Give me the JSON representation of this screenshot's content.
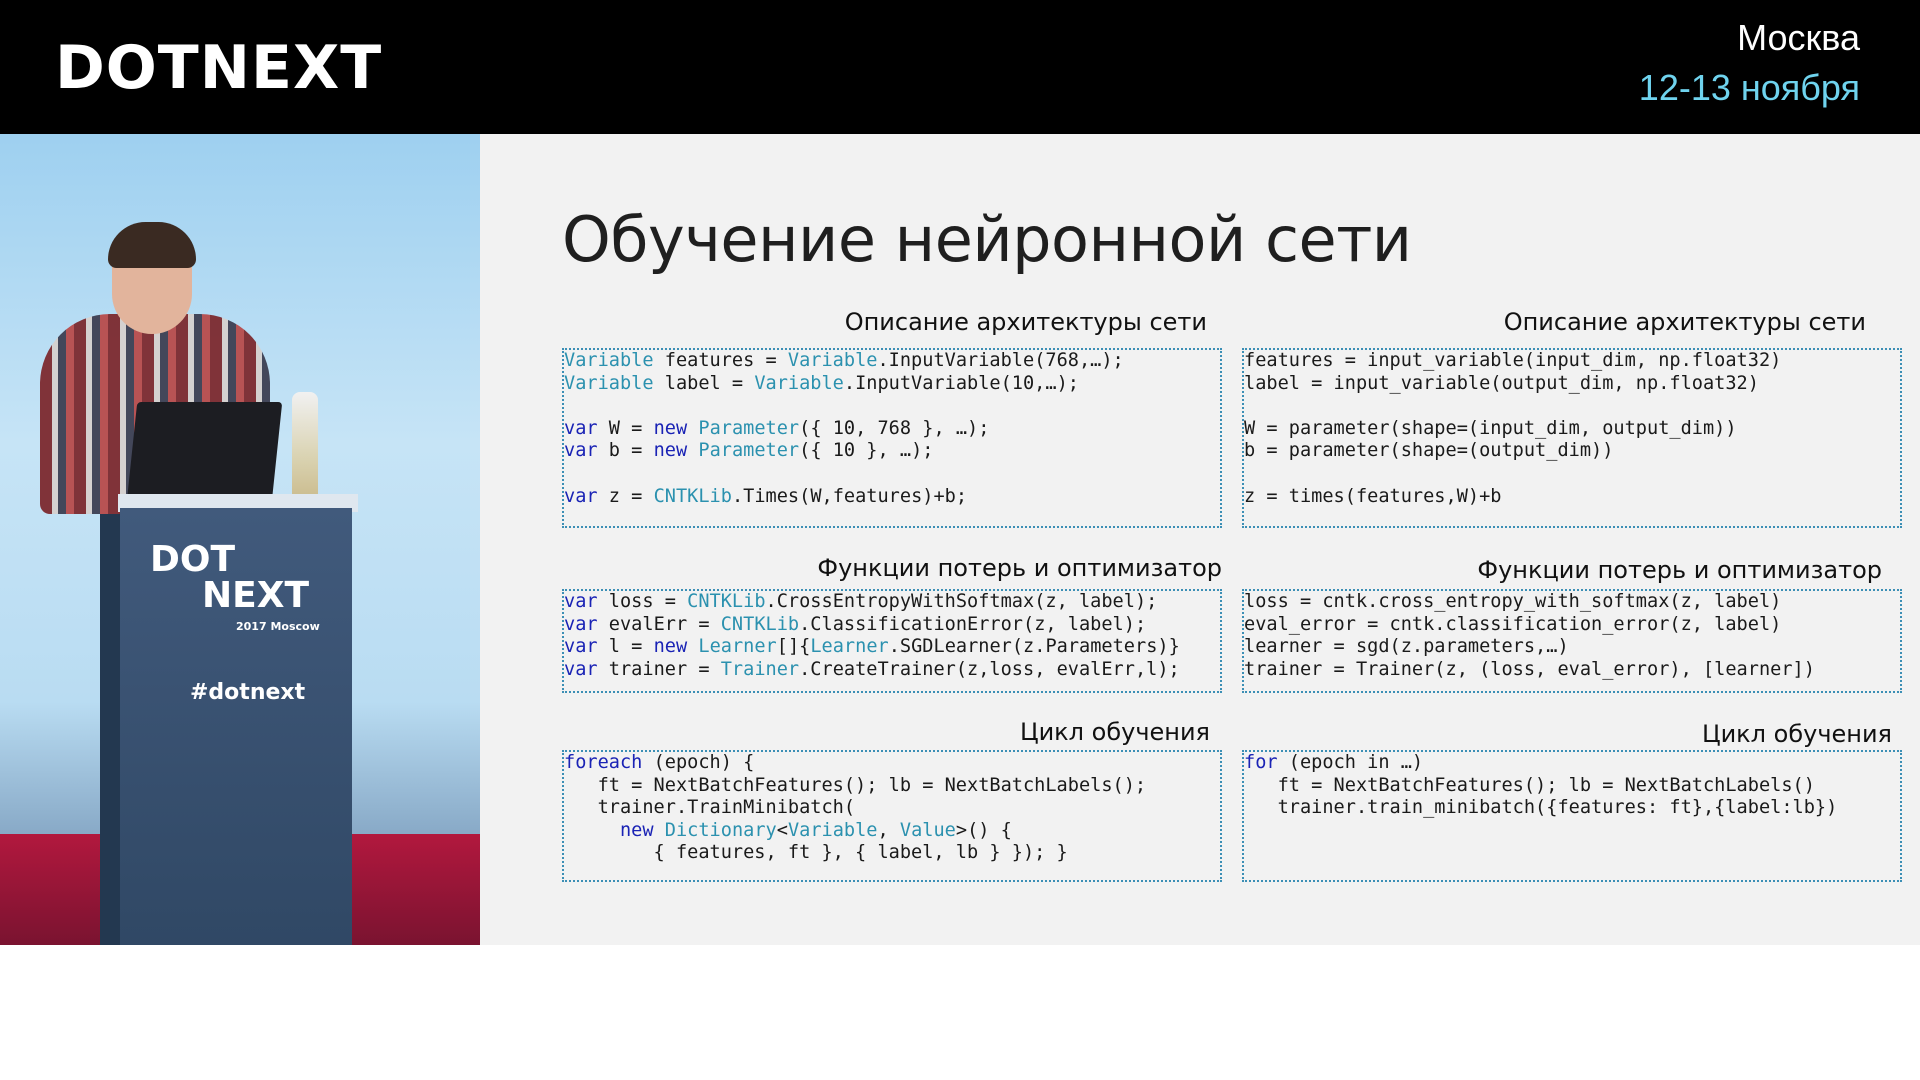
{
  "header": {
    "logo": "DOTNEXT",
    "city": "Москва",
    "dates": "12-13 ноября"
  },
  "podium": {
    "logo_line1": "DOT",
    "logo_line2": "NEXT",
    "logo_sub": "2017 Moscow",
    "hashtag": "#dotnext"
  },
  "slide": {
    "title": "Обучение нейронной сети",
    "left": {
      "arch_label": "Описание архитектуры сети",
      "loss_label": "Функции потерь и оптимизатор",
      "loop_label": "Цикл обучения",
      "arch_code": [
        [
          [
            "ty",
            "Variable"
          ],
          [
            "p",
            " features = "
          ],
          [
            "ty",
            "Variable"
          ],
          [
            "p",
            ".InputVariable(768,…);"
          ]
        ],
        [
          [
            "ty",
            "Variable"
          ],
          [
            "p",
            " label = "
          ],
          [
            "ty",
            "Variable"
          ],
          [
            "p",
            ".InputVariable(10,…);"
          ]
        ],
        [
          [
            "p",
            ""
          ]
        ],
        [
          [
            "kw",
            "var"
          ],
          [
            "p",
            " W = "
          ],
          [
            "kw",
            "new"
          ],
          [
            "p",
            " "
          ],
          [
            "ty",
            "Parameter"
          ],
          [
            "p",
            "({ 10, 768 }, …);"
          ]
        ],
        [
          [
            "kw",
            "var"
          ],
          [
            "p",
            " b = "
          ],
          [
            "kw",
            "new"
          ],
          [
            "p",
            " "
          ],
          [
            "ty",
            "Parameter"
          ],
          [
            "p",
            "({ 10 }, …);"
          ]
        ],
        [
          [
            "p",
            ""
          ]
        ],
        [
          [
            "kw",
            "var"
          ],
          [
            "p",
            " z = "
          ],
          [
            "ty",
            "CNTKLib"
          ],
          [
            "p",
            ".Times(W,features)+b;"
          ]
        ]
      ],
      "loss_code": [
        [
          [
            "kw",
            "var"
          ],
          [
            "p",
            " loss = "
          ],
          [
            "ty",
            "CNTKLib"
          ],
          [
            "p",
            ".CrossEntropyWithSoftmax(z, label);"
          ]
        ],
        [
          [
            "kw",
            "var"
          ],
          [
            "p",
            " evalErr = "
          ],
          [
            "ty",
            "CNTKLib"
          ],
          [
            "p",
            ".ClassificationError(z, label);"
          ]
        ],
        [
          [
            "kw",
            "var"
          ],
          [
            "p",
            " l = "
          ],
          [
            "kw",
            "new"
          ],
          [
            "p",
            " "
          ],
          [
            "ty",
            "Learner"
          ],
          [
            "p",
            "[]{"
          ],
          [
            "ty",
            "Learner"
          ],
          [
            "p",
            ".SGDLearner(z.Parameters)}"
          ]
        ],
        [
          [
            "kw",
            "var"
          ],
          [
            "p",
            " trainer = "
          ],
          [
            "ty",
            "Trainer"
          ],
          [
            "p",
            ".CreateTrainer(z,loss, evalErr,l);"
          ]
        ]
      ],
      "loop_code": [
        [
          [
            "kw",
            "foreach"
          ],
          [
            "p",
            " (epoch) {"
          ]
        ],
        [
          [
            "p",
            "   ft = NextBatchFeatures(); lb = NextBatchLabels();"
          ]
        ],
        [
          [
            "p",
            "   trainer.TrainMinibatch("
          ]
        ],
        [
          [
            "p",
            "     "
          ],
          [
            "kw",
            "new"
          ],
          [
            "p",
            " "
          ],
          [
            "ty",
            "Dictionary"
          ],
          [
            "p",
            "<"
          ],
          [
            "ty",
            "Variable"
          ],
          [
            "p",
            ", "
          ],
          [
            "ty",
            "Value"
          ],
          [
            "p",
            ">() {"
          ]
        ],
        [
          [
            "p",
            "        { features, ft }, { label, lb } }); }"
          ]
        ]
      ]
    },
    "right": {
      "arch_label": "Описание архитектуры сети",
      "loss_label": "Функции потерь и оптимизатор",
      "loop_label": "Цикл обучения",
      "arch_code": [
        [
          [
            "p",
            "features = input_variable(input_dim, np.float32)"
          ]
        ],
        [
          [
            "p",
            "label = input_variable(output_dim, np.float32)"
          ]
        ],
        [
          [
            "p",
            ""
          ]
        ],
        [
          [
            "p",
            "W = parameter(shape=(input_dim, output_dim))"
          ]
        ],
        [
          [
            "p",
            "b = parameter(shape=(output_dim))"
          ]
        ],
        [
          [
            "p",
            ""
          ]
        ],
        [
          [
            "p",
            "z = times(features,W)+b"
          ]
        ]
      ],
      "loss_code": [
        [
          [
            "p",
            "loss = cntk.cross_entropy_with_softmax(z, label)"
          ]
        ],
        [
          [
            "p",
            "eval_error = cntk.classification_error(z, label)"
          ]
        ],
        [
          [
            "p",
            "learner = sgd(z.parameters,…)"
          ]
        ],
        [
          [
            "p",
            "trainer = Trainer(z, (loss, eval_error), [learner])"
          ]
        ]
      ],
      "loop_code": [
        [
          [
            "kw",
            "for"
          ],
          [
            "p",
            " (epoch in …)"
          ]
        ],
        [
          [
            "p",
            "   ft = NextBatchFeatures(); lb = NextBatchLabels()"
          ]
        ],
        [
          [
            "p",
            "   trainer.train_minibatch({features: ft},{label:lb})"
          ]
        ]
      ]
    },
    "colors": {
      "keyword": "#1a23b5",
      "type": "#2b91af",
      "box_border": "#3c8fb5",
      "date_accent": "#6fd3ee"
    }
  }
}
